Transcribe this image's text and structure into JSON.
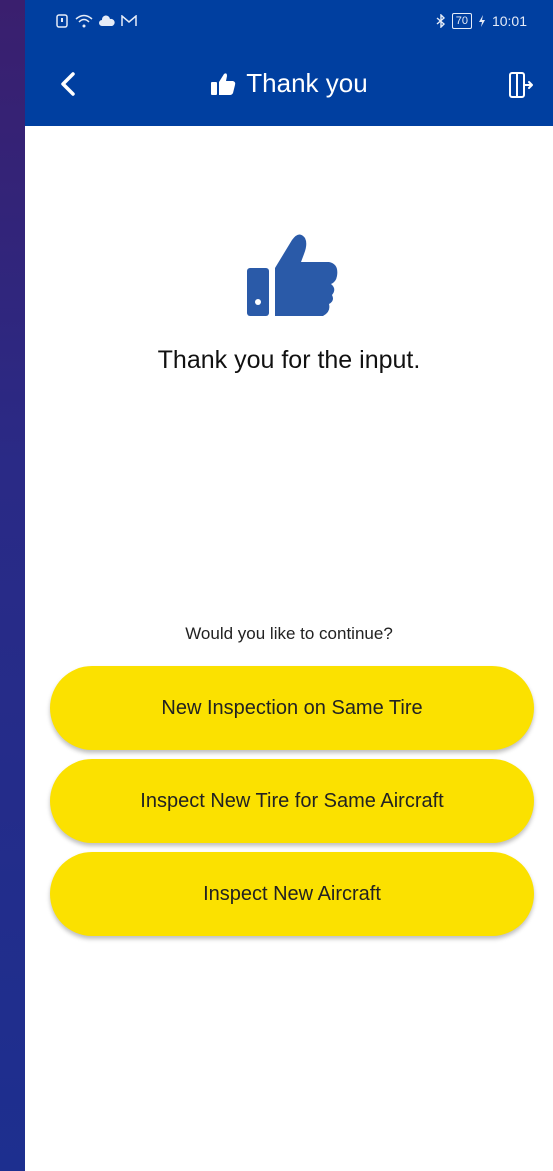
{
  "status_bar": {
    "battery": "70",
    "time": "10:01"
  },
  "header": {
    "title": "Thank you"
  },
  "main": {
    "message": "Thank you for the input.",
    "question": "Would you like to continue?",
    "buttons": [
      {
        "label": "New Inspection on Same Tire"
      },
      {
        "label": "Inspect New Tire for Same Aircraft"
      },
      {
        "label": "Inspect New Aircraft"
      }
    ]
  },
  "colors": {
    "header_bg": "#003fa0",
    "button_bg": "#fbe100",
    "icon": "#2a5aa8"
  },
  "icons": [
    "back-icon",
    "thumbs-up-icon",
    "exit-icon"
  ]
}
